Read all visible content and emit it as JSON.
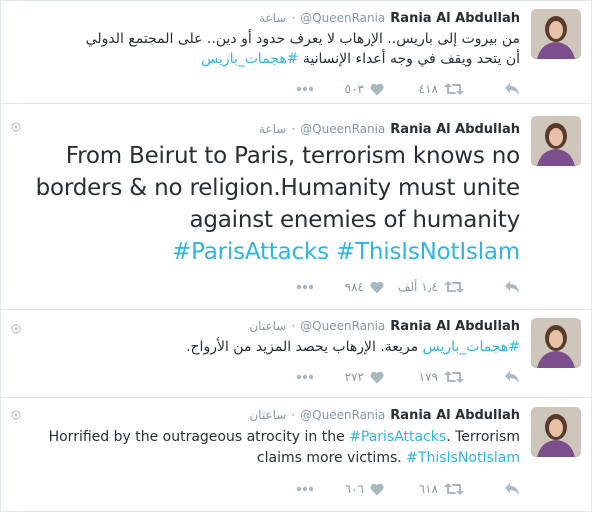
{
  "tweets": [
    {
      "name": "Rania Al Abdullah",
      "handle": "@QueenRania",
      "time": "ساعة",
      "lines": [
        [
          "من بيروت إلى باريس.. الإرهاب لا يعرف حدود أو دين.. على المجتمع الدولي"
        ],
        [
          "أن يتحد ويقف في وجه أعداء الإنسانية ",
          "#هجمات_باريس"
        ]
      ],
      "retweets": "٤١٨",
      "likes": "٥٠٣"
    },
    {
      "name": "Rania Al Abdullah",
      "handle": "@QueenRania",
      "time": "ساعة",
      "lines": [
        [
          "From Beirut to Paris, terrorism knows no"
        ],
        [
          "borders & no religion.Humanity must unite"
        ],
        [
          "against enemies of humanity"
        ],
        [
          "#ParisAttacks",
          "#ThisIsNotIslam"
        ]
      ],
      "retweets": "١٫٤ ألف",
      "likes": "٩٨٤"
    },
    {
      "name": "Rania Al Abdullah",
      "handle": "@QueenRania",
      "time": "ساعتان",
      "lines": [
        [
          "#هجمات_باريس",
          " مريعة. الإرهاب يحصد المزيد من الأرواح."
        ]
      ],
      "retweets": "١٧٩",
      "likes": "٢٧٢"
    },
    {
      "name": "Rania Al Abdullah",
      "handle": "@QueenRania",
      "time": "ساعتان",
      "lines": [
        [
          "Horrified by the outrageous atrocity in the ",
          "#ParisAttacks",
          ". Terrorism"
        ],
        [
          "claims more victims. ",
          "#ThisIsNotIslam"
        ]
      ],
      "retweets": "٦١٨",
      "likes": "٦٠٦"
    }
  ],
  "colors": {
    "hashtag": "#2fb5e3",
    "meta": "#8899a6",
    "border": "#e1e8ed",
    "icon": "#aab8c2"
  },
  "icons": {
    "reply": "reply-icon",
    "retweet": "retweet-icon",
    "like": "heart-icon",
    "more": "more-icon",
    "pin": "conversation-dot-icon"
  }
}
